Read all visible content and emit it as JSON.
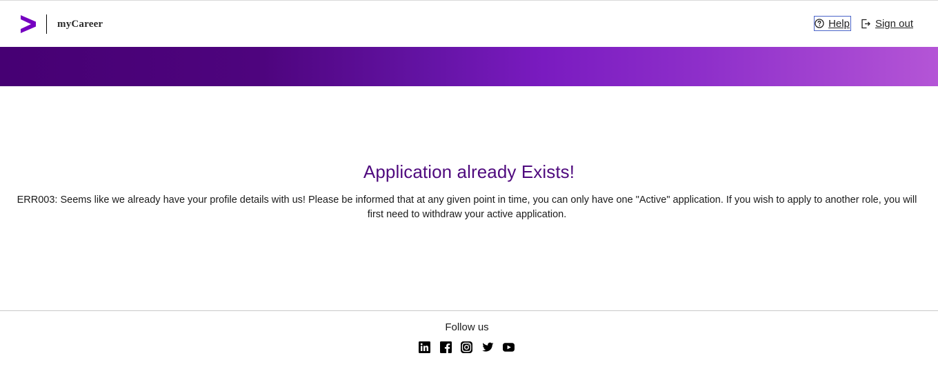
{
  "header": {
    "brand_name": "myCareer",
    "brand_logo_icon": "accenture-chevron-icon",
    "brand_color": "#7500c0",
    "help_label": "Help",
    "help_icon": "help-circle-icon",
    "signout_label": "Sign out",
    "signout_icon": "sign-out-icon"
  },
  "banner": {
    "gradient_colors": [
      "#460073",
      "#7a1bc0",
      "#b455d6"
    ]
  },
  "main": {
    "title": "Application already Exists!",
    "message": "ERR003: Seems like we already have your profile details with us! Please be informed that at any given point in time, you can only have one \"Active\" application. If you wish to apply to another role, you will first need to withdraw your active application.",
    "title_color": "#4f0a7e"
  },
  "footer": {
    "follow_label": "Follow us",
    "social_icons": [
      "linkedin-icon",
      "facebook-icon",
      "instagram-icon",
      "twitter-icon",
      "youtube-icon"
    ]
  }
}
